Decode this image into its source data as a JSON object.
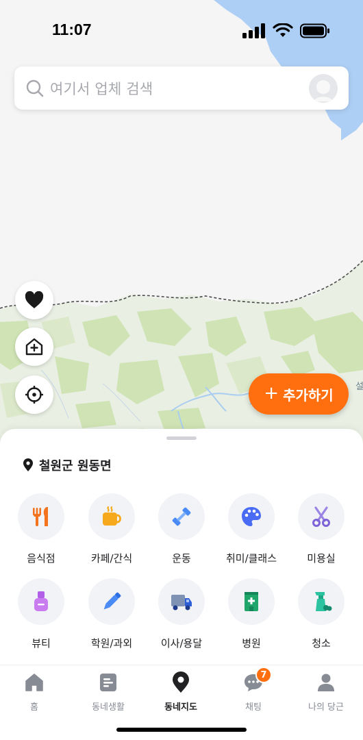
{
  "status_bar": {
    "time": "11:07"
  },
  "search": {
    "placeholder": "여기서 업체 검색"
  },
  "map": {
    "edge_label": "설"
  },
  "add_button": {
    "label": "추가하기"
  },
  "location": {
    "label": "철원군 원동면"
  },
  "categories": [
    {
      "label": "음식점",
      "icon": "utensils-icon"
    },
    {
      "label": "카페/간식",
      "icon": "coffee-cup-icon"
    },
    {
      "label": "운동",
      "icon": "dumbbell-icon"
    },
    {
      "label": "취미/클래스",
      "icon": "palette-icon"
    },
    {
      "label": "미용실",
      "icon": "scissors-icon"
    },
    {
      "label": "뷰티",
      "icon": "nail-polish-icon"
    },
    {
      "label": "학원/과외",
      "icon": "pencil-icon"
    },
    {
      "label": "이사/용달",
      "icon": "truck-icon"
    },
    {
      "label": "병원",
      "icon": "hospital-icon"
    },
    {
      "label": "청소",
      "icon": "spray-bottle-icon"
    }
  ],
  "tabs": [
    {
      "label": "홈",
      "icon": "home-icon"
    },
    {
      "label": "동네생활",
      "icon": "board-icon"
    },
    {
      "label": "동네지도",
      "icon": "map-pin-icon",
      "active": true
    },
    {
      "label": "채팅",
      "icon": "chat-icon",
      "badge": "7"
    },
    {
      "label": "나의 당근",
      "icon": "person-icon"
    }
  ],
  "colors": {
    "brand": "#ff6f0f",
    "text": "#212124",
    "muted": "#868b94"
  }
}
